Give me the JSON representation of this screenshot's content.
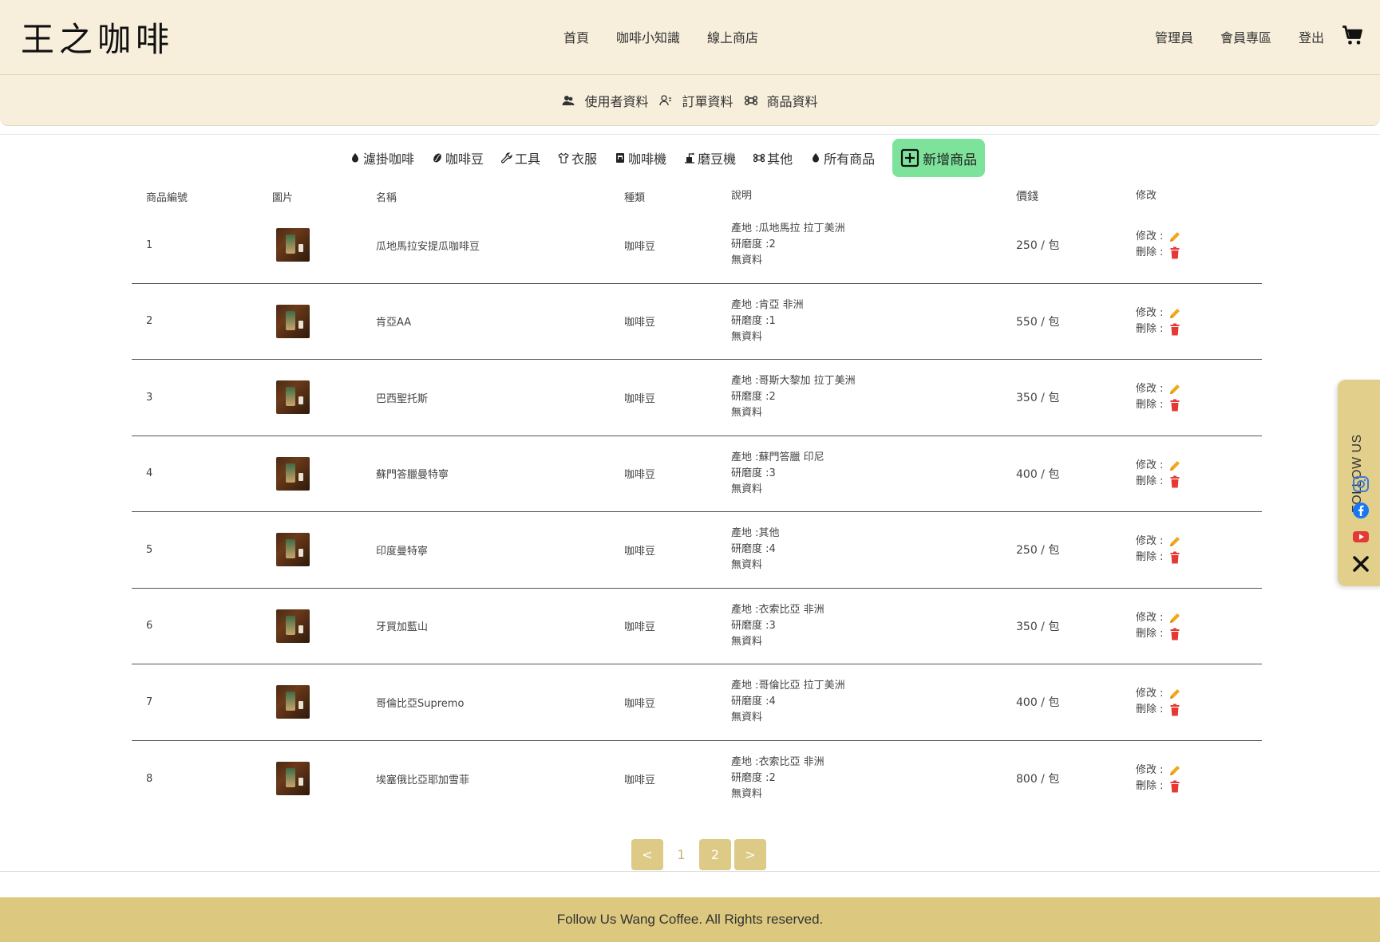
{
  "logo": "王之咖啡",
  "main_nav": [
    "首頁",
    "咖啡小知識",
    "線上商店"
  ],
  "right_nav": [
    "管理員",
    "會員專區",
    "登出"
  ],
  "admin_nav": [
    {
      "label": "使用者資料",
      "icon": "users-icon"
    },
    {
      "label": "訂單資料",
      "icon": "user-list-icon"
    },
    {
      "label": "商品資料",
      "icon": "command-icon"
    }
  ],
  "categories": [
    {
      "label": "濾掛咖啡",
      "icon": "drip-bag-icon"
    },
    {
      "label": "咖啡豆",
      "icon": "coffee-bean-icon"
    },
    {
      "label": "工具",
      "icon": "wrench-icon"
    },
    {
      "label": "衣服",
      "icon": "shirt-icon"
    },
    {
      "label": "咖啡機",
      "icon": "coffee-machine-icon"
    },
    {
      "label": "磨豆機",
      "icon": "grinder-icon"
    },
    {
      "label": "其他",
      "icon": "command-icon"
    },
    {
      "label": "所有商品",
      "icon": "drip-bag-icon"
    }
  ],
  "add_button": "新增商品",
  "table": {
    "headers": [
      "商品編號",
      "圖片",
      "名稱",
      "種類",
      "說明",
      "價錢",
      "修改"
    ],
    "rows": [
      {
        "id": "1",
        "name": "瓜地馬拉安提瓜咖啡豆",
        "type": "咖啡豆",
        "desc": [
          "產地 :瓜地馬拉 拉丁美洲",
          "研磨度 :2",
          "無資料"
        ],
        "price": "250 / 包"
      },
      {
        "id": "2",
        "name": "肯亞AA",
        "type": "咖啡豆",
        "desc": [
          "產地 :肯亞 非洲",
          "研磨度 :1",
          "無資料"
        ],
        "price": "550 / 包"
      },
      {
        "id": "3",
        "name": "巴西聖托斯",
        "type": "咖啡豆",
        "desc": [
          "產地 :哥斯大黎加 拉丁美洲",
          "研磨度 :2",
          "無資料"
        ],
        "price": "350 / 包"
      },
      {
        "id": "4",
        "name": "蘇門答臘曼特寧",
        "type": "咖啡豆",
        "desc": [
          "產地 :蘇門答臘 印尼",
          "研磨度 :3",
          "無資料"
        ],
        "price": "400 / 包"
      },
      {
        "id": "5",
        "name": "印度曼特寧",
        "type": "咖啡豆",
        "desc": [
          "產地 :其他",
          "研磨度 :4",
          "無資料"
        ],
        "price": "250 / 包"
      },
      {
        "id": "6",
        "name": "牙買加藍山",
        "type": "咖啡豆",
        "desc": [
          "產地 :衣索比亞 非洲",
          "研磨度 :3",
          "無資料"
        ],
        "price": "350 / 包"
      },
      {
        "id": "7",
        "name": "哥倫比亞Supremo",
        "type": "咖啡豆",
        "desc": [
          "產地 :哥倫比亞 拉丁美洲",
          "研磨度 :4",
          "無資料"
        ],
        "price": "400 / 包"
      },
      {
        "id": "8",
        "name": "埃塞俄比亞耶加雪菲",
        "type": "咖啡豆",
        "desc": [
          "產地 :衣索比亞 非洲",
          "研磨度 :2",
          "無資料"
        ],
        "price": "800 / 包"
      }
    ],
    "edit_label": "修改 :",
    "delete_label": "刪除 :"
  },
  "pagination": {
    "prev": "<",
    "pages": [
      "1",
      "2"
    ],
    "current": "2",
    "next": ">"
  },
  "footer": "Follow Us Wang Coffee. All Rights reserved.",
  "follow": {
    "label": "FOLLOW US",
    "icons": [
      "instagram-icon",
      "facebook-icon",
      "youtube-icon",
      "x-icon"
    ]
  },
  "colors": {
    "header_bg": "#f7efdc",
    "accent_green": "#7de39b",
    "pager_gold": "#dcca86",
    "footer_gold": "#dcc97f",
    "edit_orange": "#f0a81a",
    "delete_red": "#e53935"
  }
}
